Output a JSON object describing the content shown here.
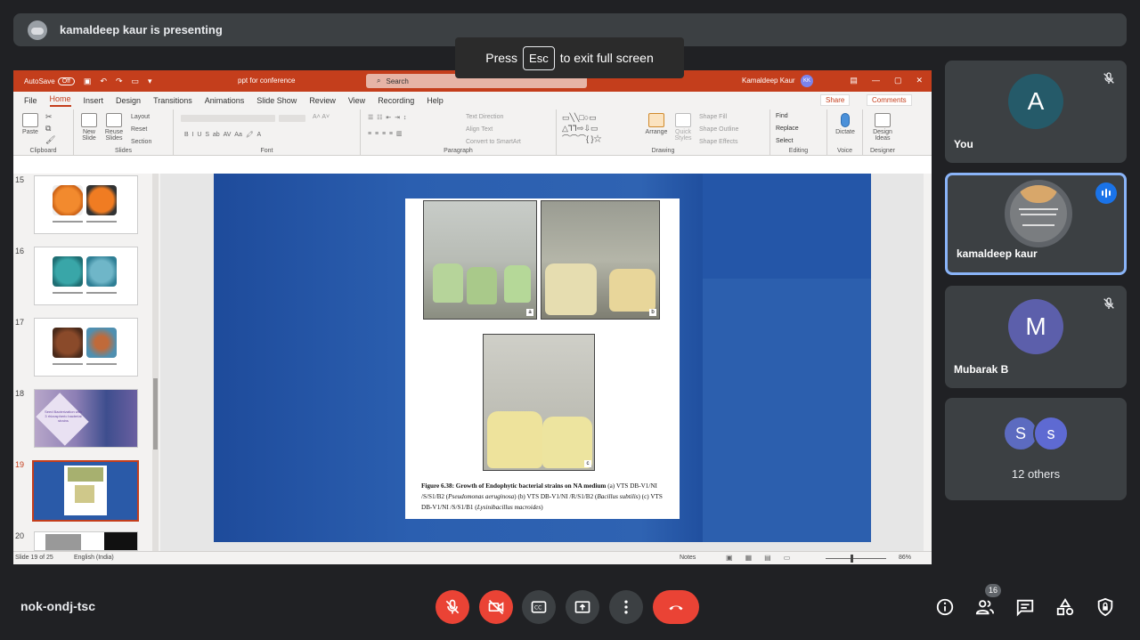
{
  "banner": {
    "presenter_text": "kamaldeep kaur is presenting"
  },
  "toast": {
    "press": "Press",
    "key": "Esc",
    "rest": "to exit full screen"
  },
  "ppt": {
    "autosave": "AutoSave",
    "autosave_state": "Off",
    "doc_title": "ppt for conference",
    "search_placeholder": "Search",
    "user_name": "Kamaldeep Kaur",
    "user_initials": "KK",
    "menu": [
      "File",
      "Home",
      "Insert",
      "Design",
      "Transitions",
      "Animations",
      "Slide Show",
      "Review",
      "View",
      "Recording",
      "Help"
    ],
    "active_tab": "Home",
    "share": "Share",
    "comments": "Comments",
    "ribbon": {
      "clipboard": "Clipboard",
      "paste": "Paste",
      "slides": "Slides",
      "new_slide": "New Slide",
      "reuse_slides": "Reuse Slides",
      "layout": "Layout",
      "reset": "Reset",
      "section": "Section",
      "font": "Font",
      "paragraph": "Paragraph",
      "text_direction": "Text Direction",
      "align_text": "Align Text",
      "convert_smartart": "Convert to SmartArt",
      "drawing": "Drawing",
      "arrange": "Arrange",
      "quick_styles": "Quick Styles",
      "shape_fill": "Shape Fill",
      "shape_outline": "Shape Outline",
      "shape_effects": "Shape Effects",
      "editing": "Editing",
      "find": "Find",
      "replace": "Replace",
      "select": "Select",
      "voice": "Voice",
      "dictate": "Dictate",
      "designer": "Designer",
      "design_ideas": "Design Ideas"
    },
    "thumb_numbers": [
      "15",
      "16",
      "17",
      "18",
      "19",
      "20"
    ],
    "slide18_text": "Seed Bacterization with 3 rhizospheric bacterial strains",
    "status": {
      "slide": "Slide 19 of 25",
      "lang": "English (India)",
      "notes": "Notes",
      "zoom": "86%"
    },
    "caption": {
      "bold1": "Figure 6.38: Growth of Endophytic bacterial strains on NA medium",
      "p1": " (a) VTS DB-V1/NI /S/S1/B2 (",
      "i1": "Pseudomonas aeruginosa",
      "p2": ") (b) VTS DB-V1/NI /R/S1/B2 (",
      "i2": "Bacillus subtilis",
      "p3": ") (c) VTS DB-V1/NI /S/S1/B1 (",
      "i3": "Lysinibacillus macroides",
      "p4": ")"
    },
    "photo_labels": [
      "a",
      "b",
      "c"
    ]
  },
  "participants": [
    {
      "name": "You",
      "initial": "A",
      "color": "#255a69",
      "muted": true
    },
    {
      "name": "kamaldeep kaur",
      "speaking": true
    },
    {
      "name": "Mubarak B",
      "initial": "M",
      "color": "#5c5fab",
      "muted": true
    },
    {
      "others_initials": [
        "S",
        "s"
      ],
      "others_label": "12 others"
    }
  ],
  "meeting": {
    "code": "nok-ondj-tsc",
    "participant_count": "16"
  },
  "colors": {
    "end_call": "#ea4335",
    "ppt_brand": "#c43e1c",
    "active_speaker": "#8ab4f8"
  }
}
